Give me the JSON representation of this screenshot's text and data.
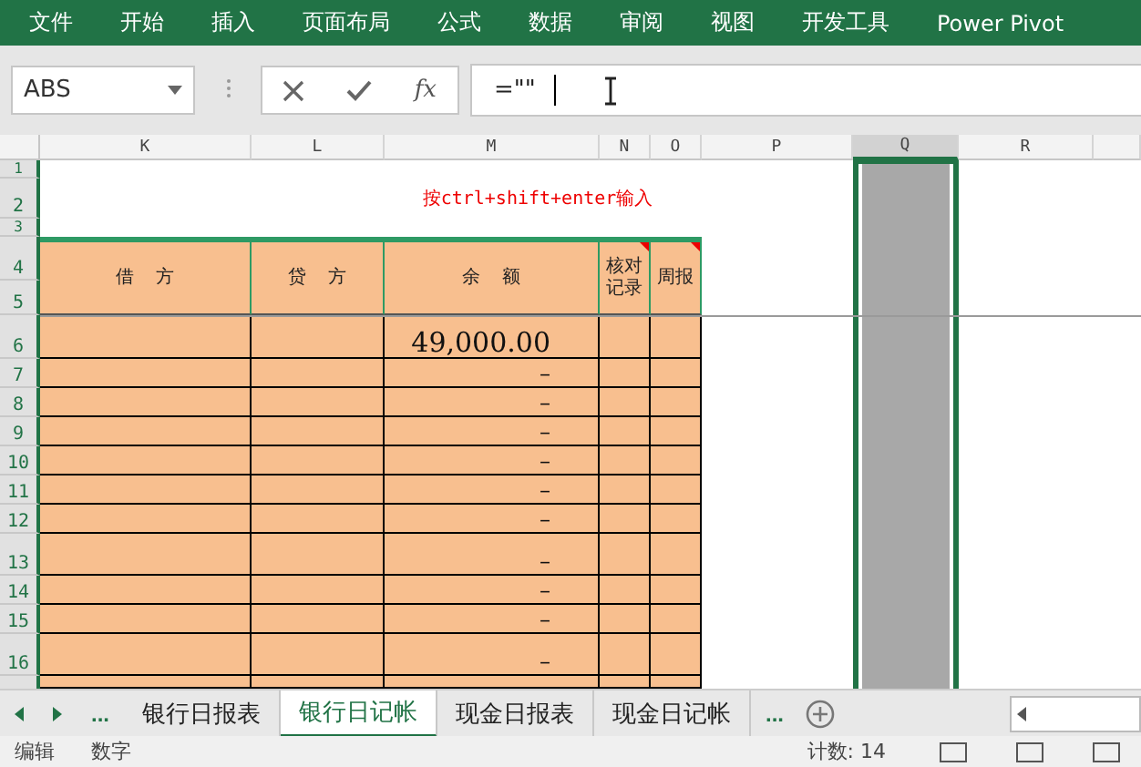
{
  "ribbon_tabs": [
    "文件",
    "开始",
    "插入",
    "页面布局",
    "公式",
    "数据",
    "审阅",
    "视图",
    "开发工具",
    "Power Pivot"
  ],
  "name_box": {
    "value": "ABS"
  },
  "formula_bar": {
    "function_label": "fx",
    "value": "=\"\""
  },
  "columns": [
    {
      "label": "K",
      "selected": false
    },
    {
      "label": "L",
      "selected": false
    },
    {
      "label": "M",
      "selected": false
    },
    {
      "label": "N",
      "selected": false
    },
    {
      "label": "O",
      "selected": false
    },
    {
      "label": "P",
      "selected": false
    },
    {
      "label": "Q",
      "selected": true
    },
    {
      "label": "R",
      "selected": false
    }
  ],
  "row_numbers": [
    "1",
    "2",
    "3",
    "4",
    "5",
    "6",
    "7",
    "8",
    "9",
    "10",
    "11",
    "12",
    "13",
    "14",
    "15",
    "16"
  ],
  "note": "按ctrl+shift+enter输入",
  "table_headers": [
    {
      "label": "借  方",
      "comment": false
    },
    {
      "label": "贷  方",
      "comment": false
    },
    {
      "label": "余  额",
      "comment": false
    },
    {
      "label": "核对记录",
      "comment": true
    },
    {
      "label": "周报",
      "comment": true
    }
  ],
  "balances": [
    "49,000.00",
    "–",
    "–",
    "–",
    "–",
    "–",
    "–",
    "–",
    "–",
    "–",
    "–"
  ],
  "sheet_nav": {
    "more_left": "...",
    "more_right": "..."
  },
  "sheet_tabs": [
    {
      "label": "银行日报表",
      "selected": false
    },
    {
      "label": "银行日记帐",
      "selected": true
    },
    {
      "label": "现金日报表",
      "selected": false
    },
    {
      "label": "现金日记帐",
      "selected": false
    }
  ],
  "status_bar": {
    "mode": "编辑",
    "format": "数字",
    "count": "计数: 14"
  }
}
